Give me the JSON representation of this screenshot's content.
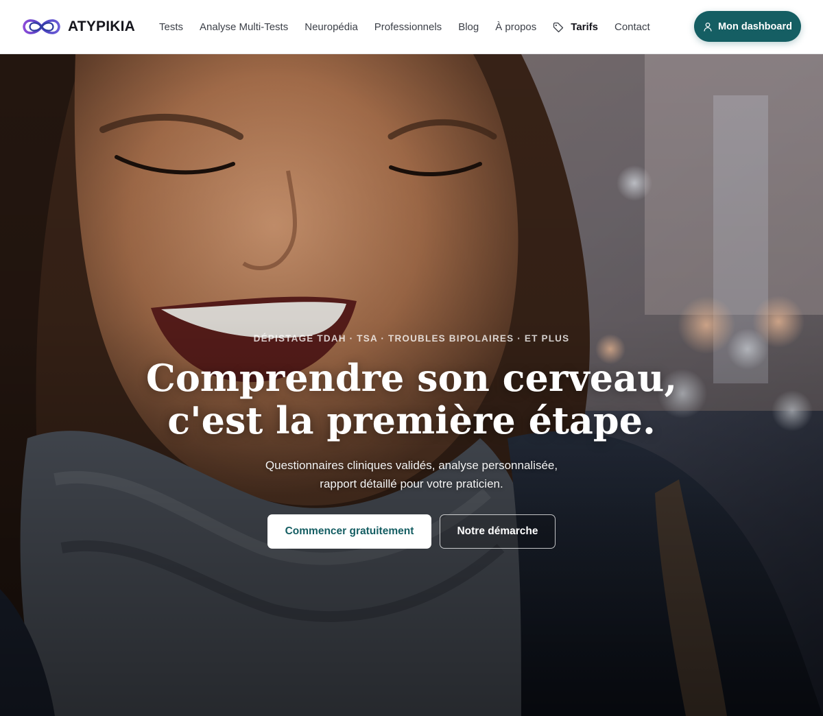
{
  "brand": {
    "name": "ATYPIKIA",
    "logo_colors": [
      "#6b5bd6",
      "#2f3d9e",
      "#8c4bd8"
    ]
  },
  "nav": {
    "items": [
      {
        "label": "Tests"
      },
      {
        "label": "Analyse Multi-Tests"
      },
      {
        "label": "Neuropédia"
      },
      {
        "label": "Professionnels"
      },
      {
        "label": "Blog"
      },
      {
        "label": "À propos"
      },
      {
        "label": "Tarifs",
        "icon": "tag-icon",
        "active": true
      },
      {
        "label": "Contact"
      }
    ]
  },
  "header": {
    "dashboard_label": "Mon dashboard",
    "dashboard_icon": "user-icon",
    "accent_color": "#155e63"
  },
  "hero": {
    "eyebrow": "DÉPISTAGE TDAH · TSA · TROUBLES BIPOLAIRES · ET PLUS",
    "headline_line1": "Comprendre son cerveau,",
    "headline_line2": "c'est la première étape.",
    "subtitle_line1": "Questionnaires cliniques validés, analyse personnalisée,",
    "subtitle_line2": "rapport détaillé pour votre praticien.",
    "cta_primary": "Commencer gratuitement",
    "cta_secondary": "Notre démarche",
    "background_image": "smiling-woman-photo"
  }
}
